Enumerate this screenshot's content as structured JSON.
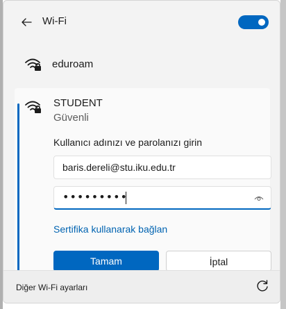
{
  "header": {
    "back_icon": "arrow-left-icon",
    "title": "Wi-Fi",
    "toggle_on": true
  },
  "networks": [
    {
      "name": "eduroam",
      "icon": "wifi-secured-icon"
    }
  ],
  "connecting": {
    "ssid": "STUDENT",
    "security": "Güvenli",
    "prompt": "Kullanıcı adınızı ve parolanızı girin",
    "username_value": "baris.dereli@stu.iku.edu.tr",
    "password_masked": "•••••••••",
    "reveal_icon": "eye-icon",
    "cert_link": "Sertifika kullanarak bağlan",
    "ok_label": "Tamam",
    "cancel_label": "İptal"
  },
  "footer": {
    "settings_link": "Diğer Wi-Fi ayarları",
    "refresh_icon": "refresh-icon"
  },
  "colors": {
    "accent": "#0067c0",
    "link": "#0063b1",
    "panel_bg": "#f3f3f3"
  }
}
